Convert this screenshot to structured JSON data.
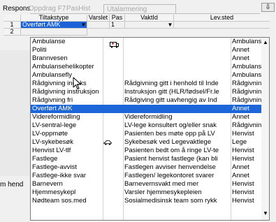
{
  "tabs": {
    "active": "Respons",
    "inactive": [
      "Oppdrag F7",
      "PasHist",
      "Utalarmering"
    ],
    "pin": "⇩"
  },
  "grid": {
    "headers": [
      "Tiltakstype",
      "Varslet",
      "Pas",
      "VaktId",
      "Lev.sted"
    ],
    "rows": [
      {
        "num": "1",
        "tiltakstype": "Overført AMK",
        "pas": "1"
      },
      {
        "num": "2",
        "tiltakstype": ""
      }
    ]
  },
  "background": {
    "left_fragment": "m hend"
  },
  "dropdown": {
    "items": [
      {
        "name": "Ambulanse",
        "desc": "",
        "lev": "Ambulanse",
        "icon": "ambulance-icon"
      },
      {
        "name": "Politi",
        "desc": "",
        "lev": "Annet"
      },
      {
        "name": "Brannvesen",
        "desc": "",
        "lev": "Annet"
      },
      {
        "name": "Ambulansehelikopter",
        "desc": "",
        "lev": "Ambulanse"
      },
      {
        "name": "Ambulansefly",
        "desc": "",
        "lev": "Ambulanse"
      },
      {
        "name": "Rådgivning indeks",
        "desc": "Rådgivning gitt i henhold til Inde",
        "lev": "Rådgivninc"
      },
      {
        "name": "Rådgivning instruksjon",
        "desc": "Instruksjon gitt (HLR/fødsel/Fr.le",
        "lev": "Rådgivninc"
      },
      {
        "name": "Rådgivning fri",
        "desc": "Rådgiving gitt uavhengig av Ind",
        "lev": "Rådgivninc"
      },
      {
        "name": "Overført AMK",
        "desc": "",
        "lev": "Annet",
        "selected": true
      },
      {
        "name": "Videreformidling",
        "desc": "Videreformidling",
        "lev": "Annet"
      },
      {
        "name": "LV-sentral-lege",
        "desc": "LV-lege konsultert og/eller snak",
        "lev": "Rådgivninc"
      },
      {
        "name": "LV-oppmøte",
        "desc": "Pasienten bes møte opp på LV",
        "lev": "Henvist"
      },
      {
        "name": "LV-sykebesøk",
        "desc": "Sykebesøk ved Legevaktlege",
        "lev": "Lege",
        "icon": "car-icon"
      },
      {
        "name": "Henvist LV-tlf",
        "desc": "Pasienten bedt om å ringe LV-te",
        "lev": "Henvist"
      },
      {
        "name": "Fastlege",
        "desc": "Pasient henvist fastlege (kan bli",
        "lev": "Henvist"
      },
      {
        "name": "Fastlege-avvist",
        "desc": "Fastlegen avviser henvendelse",
        "lev": "Annet"
      },
      {
        "name": "Fastlege-ikke svar",
        "desc": "Fastlegen/ legekontoret svarer",
        "lev": "Annet"
      },
      {
        "name": "Barnevern",
        "desc": "Barnevernsvakt med mer",
        "lev": "Henvist"
      },
      {
        "name": "Hjemmesykepl",
        "desc": "Varsler hjemmesykepleien",
        "lev": "Henvist"
      },
      {
        "name": "Nødteam sos.med",
        "desc": "Sosialmedisinsk team som rykk",
        "lev": "Henvist"
      }
    ]
  },
  "colors": {
    "selection": "#1b61d8",
    "list_bg": "#ffffff",
    "panel_bg": "#f0f0f0"
  }
}
